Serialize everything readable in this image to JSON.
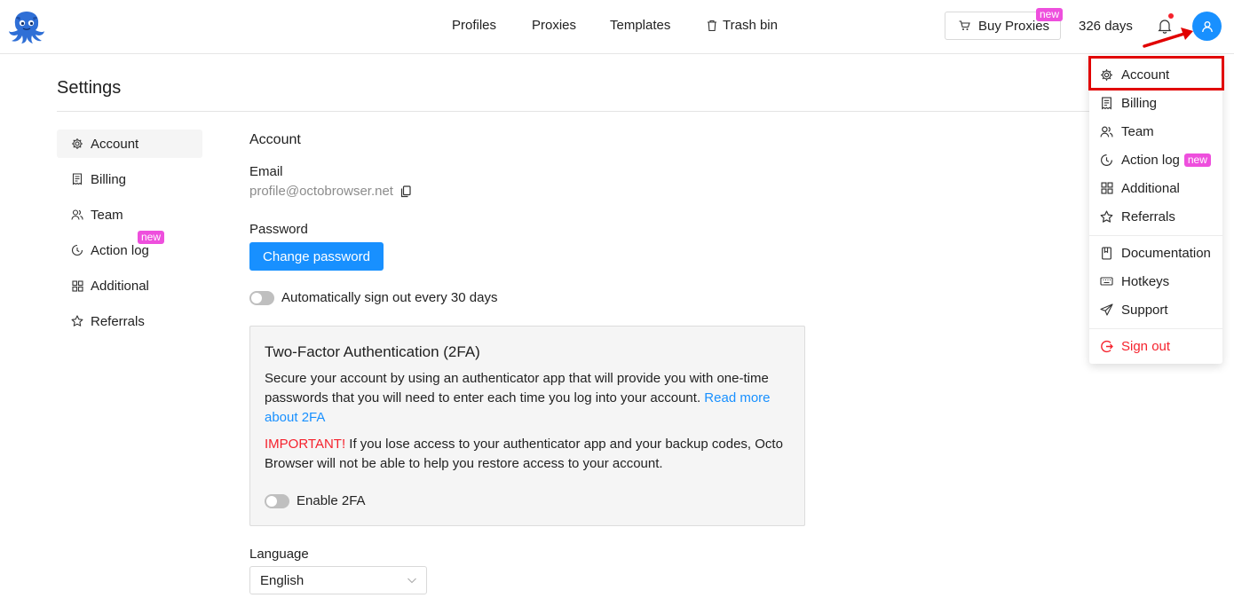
{
  "topbar": {
    "nav": [
      "Profiles",
      "Proxies",
      "Templates"
    ],
    "trash_label": "Trash bin",
    "buy_label": "Buy Proxies",
    "buy_badge": "new",
    "days": "326 days"
  },
  "page": {
    "title": "Settings"
  },
  "sidebar": {
    "items": [
      "Account",
      "Billing",
      "Team",
      "Action log",
      "Additional",
      "Referrals"
    ],
    "action_log_badge": "new"
  },
  "account": {
    "section_title": "Account",
    "email_label": "Email",
    "email_value": "profile@octobrowser.net",
    "password_label": "Password",
    "change_password": "Change password",
    "auto_signout": "Automatically sign out every 30 days",
    "tfa_title": "Two-Factor Authentication (2FA)",
    "tfa_desc": "Secure your account by using an authenticator app that will provide you with one-time passwords that you will need to enter each time you log into your account.",
    "tfa_read_more": "Read more about 2FA",
    "tfa_important": "IMPORTANT!",
    "tfa_warning": "If you lose access to your authenticator app and your backup codes, Octo Browser will not be able to help you restore access to your account.",
    "enable_2fa": "Enable 2FA",
    "language_label": "Language",
    "language_value": "English"
  },
  "dropdown": {
    "items": [
      "Account",
      "Billing",
      "Team",
      "Action log",
      "Additional",
      "Referrals",
      "Documentation",
      "Hotkeys",
      "Support",
      "Sign out"
    ],
    "action_log_badge": "new"
  },
  "colors": {
    "primary": "#1890ff",
    "danger": "#f5222d",
    "badge": "#ee4fdd",
    "highlight": "#e10000"
  }
}
